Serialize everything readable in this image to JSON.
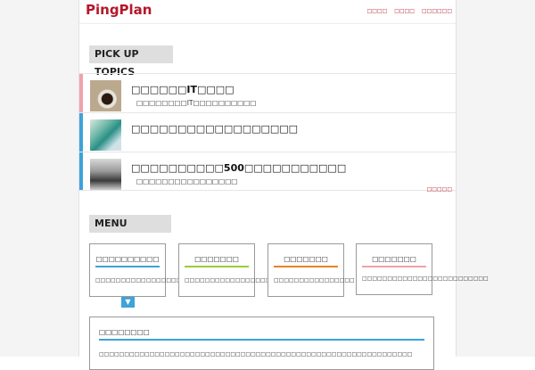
{
  "header": {
    "brand": "PingPlan",
    "nav": [
      "□□□□",
      "□□□□",
      "□□□□□□"
    ]
  },
  "pickup": {
    "label": "PICK UP TOPICS",
    "items": [
      {
        "title": "□□□□□□IT□□□□",
        "subtitle": "□□□□□□□□IT□□□□□□□□□□",
        "thumb": "coffee-photo",
        "accent": "#eea3ab"
      },
      {
        "title": "□□□□□□□□□□□□□□□□□□",
        "subtitle": "",
        "thumb": "leaf-photo",
        "accent": "#3da3d8"
      },
      {
        "title": "□□□□□□□□□□500□□□□□□□□□□□",
        "subtitle": "□□□□□□□□□□□□□□□□",
        "thumb": "desk-photo",
        "accent": "#3da3d8"
      }
    ],
    "more_link": "□□□□□"
  },
  "menu": {
    "label": "MENU",
    "cards": [
      {
        "title": "□□□□□□□□□□",
        "desc": "□□□□□□□□□□□□□□□□□□□□□□□",
        "accent": "#3da3d8"
      },
      {
        "title": "□□□□□□□",
        "desc": "□□□□□□□□□□□□□□□□□□□□□□",
        "accent": "#9ccb3b"
      },
      {
        "title": "□□□□□□□",
        "desc": "□□□□□□□□□□□□□□□□",
        "accent": "#e8832a"
      },
      {
        "title": "□□□□□□□",
        "desc": "□□□□□□□□□□□□□□□□□□□□□□□□□",
        "accent": "#eea3ab"
      }
    ],
    "toggle_symbol": "▼"
  },
  "panel": {
    "title": "□□□□□□□□",
    "text": "□□□□□□□□□□□□□□□□□□□□□□□□□□□□□□□□□□□□□□□□□□□□□□□□□□□□□□□□□□□□□□"
  },
  "colors": {
    "brand": "#b5172a",
    "blue": "#3da3d8",
    "green": "#9ccb3b",
    "orange": "#e8832a",
    "pink": "#eea3ab"
  }
}
